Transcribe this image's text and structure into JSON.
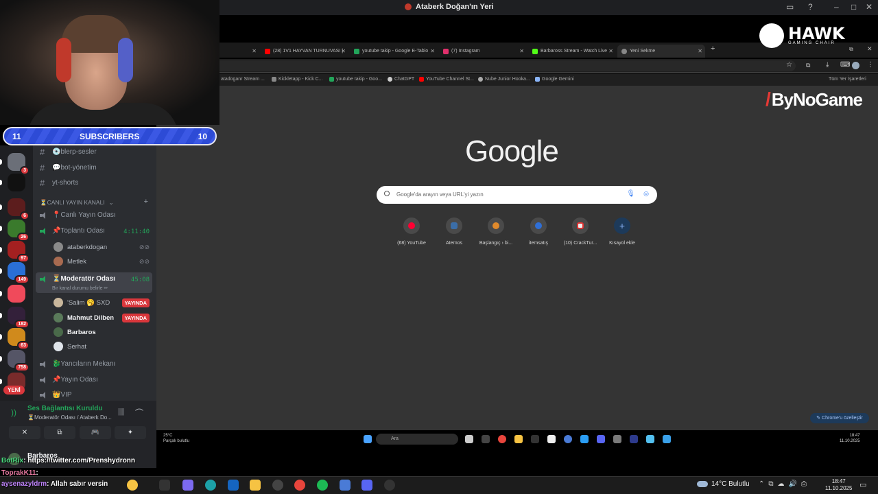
{
  "window": {
    "title": "Ataberk Doğan'ın Yeri"
  },
  "subscribers": {
    "left": "11",
    "label": "SUBSCRIBERS",
    "right": "10"
  },
  "servers": [
    {
      "badge": "3",
      "color": "#6b6f78"
    },
    {
      "badge": "",
      "color": "#111"
    },
    {
      "badge": "6",
      "color": "#5c1d1d"
    },
    {
      "badge": "26",
      "color": "#3a7a2c"
    },
    {
      "badge": "97",
      "color": "#a42020"
    },
    {
      "badge": "149",
      "color": "#2a6fd6"
    },
    {
      "badge": "",
      "color": "#f04a5b"
    },
    {
      "badge": "182",
      "color": "#33203a"
    },
    {
      "badge": "63",
      "color": "#d08a1c"
    },
    {
      "badge": "758",
      "color": "#556"
    },
    {
      "badge": "",
      "color": "#7a2b2b"
    }
  ],
  "server_new_badge": "YENİ",
  "channels": {
    "text": [
      {
        "label": "💿blerp-sesler"
      },
      {
        "label": "💬bot-yönetim"
      },
      {
        "label": "yt-shorts"
      }
    ],
    "category": "⏳CANLI YAYIN KANALI",
    "voice": [
      {
        "label": "📍Canlı Yayın Odası"
      },
      {
        "label": "📌Toplantı Odası",
        "timer": "4:11:40"
      },
      {
        "label": "⏳Moderatör Odası",
        "timer": "45:08",
        "status": "Bir kanal durumu belirle ✏"
      },
      {
        "label": "🐉Yancıların Mekanı"
      },
      {
        "label": "📌Yayın Odası"
      },
      {
        "label": "👑VIP"
      }
    ],
    "meeting_users": [
      {
        "name": "ataberkdogan"
      },
      {
        "name": "Metlek"
      }
    ],
    "mod_users": [
      {
        "name": "'Salim 🥱 SXD",
        "live": "YAYINDA"
      },
      {
        "name": "Mahmut Dilben",
        "live": "YAYINDA"
      },
      {
        "name": "Barbaros"
      },
      {
        "name": "Serhat"
      }
    ]
  },
  "voice_panel": {
    "status": "Ses Bağlantısı Kuruldu",
    "room": "⏳Moderatör Odası / Ataberk Do...",
    "buttons": [
      "✕",
      "⧉",
      "🎮",
      "✦"
    ]
  },
  "profile": {
    "name": "Barbaros"
  },
  "chat": [
    {
      "user": "BotRix",
      "text": ": https://twitter.com/Prenshydronn",
      "color": "#4ade80"
    },
    {
      "user": "ToprakK11",
      "text": ":",
      "color": "#e879a0"
    },
    {
      "user": "aysenazyldrm",
      "text": ": Allah sabır versin",
      "color": "#c084fc"
    }
  ],
  "browser": {
    "tabs": [
      {
        "label": "(28) 1V1 HAYVAN TURNUVASI |",
        "color": "#ff0000"
      },
      {
        "label": "youtube takip - Google E-Tablo",
        "color": "#22a55a"
      },
      {
        "label": "(7) Instagram",
        "color": "#e1306c"
      },
      {
        "label": "Barbaross Stream - Watch Live",
        "color": "#53fc18"
      },
      {
        "label": "Yeni Sekme",
        "color": "#888"
      }
    ],
    "bookmarks": [
      {
        "label": "atadoganr Stream ...",
        "color": "#53fc18"
      },
      {
        "label": "Kickletapp - Kick C...",
        "color": "#888"
      },
      {
        "label": "youtube takip - Goo...",
        "color": "#22a55a"
      },
      {
        "label": "ChatGPT",
        "color": "#ccc"
      },
      {
        "label": "YouTube Channel St...",
        "color": "#ff0000"
      },
      {
        "label": "Nube Junior Hooka...",
        "color": "#aaa"
      },
      {
        "label": "Google Gemini",
        "color": "#8ab4f8"
      }
    ],
    "bookmarks_right": "Tüm Yer İşaretleri"
  },
  "newtab": {
    "logo": "Google",
    "search_placeholder": "Google'da arayın veya URL'yi yazın",
    "shortcuts": [
      {
        "label": "(68) YouTube",
        "color": "#ff0033"
      },
      {
        "label": "Aternos",
        "color": "#3b6ea8"
      },
      {
        "label": "Başlangıç › bi...",
        "color": "#e08a2c"
      },
      {
        "label": "itemsatış",
        "color": "#2f6fd6"
      },
      {
        "label": "(10) CrackTur...",
        "color": "#d33"
      },
      {
        "label": "Kısayol ekle",
        "color": "#8ab4f8"
      }
    ],
    "customize": "✎ Chrome'u özelleştir"
  },
  "logos": {
    "hawk": "HAWK",
    "hawk_sub": "GAMING CHAIR",
    "bynogame": "ByNoGame"
  },
  "inner_taskbar": {
    "weather_temp": "25°C",
    "weather_text": "Parçalı bulutlu",
    "search": "Ara",
    "time": "18:47",
    "date": "11.10.2025"
  },
  "taskbar": {
    "weather": "14°C  Bulutlu",
    "time": "18:47",
    "date": "11.10.2025"
  }
}
